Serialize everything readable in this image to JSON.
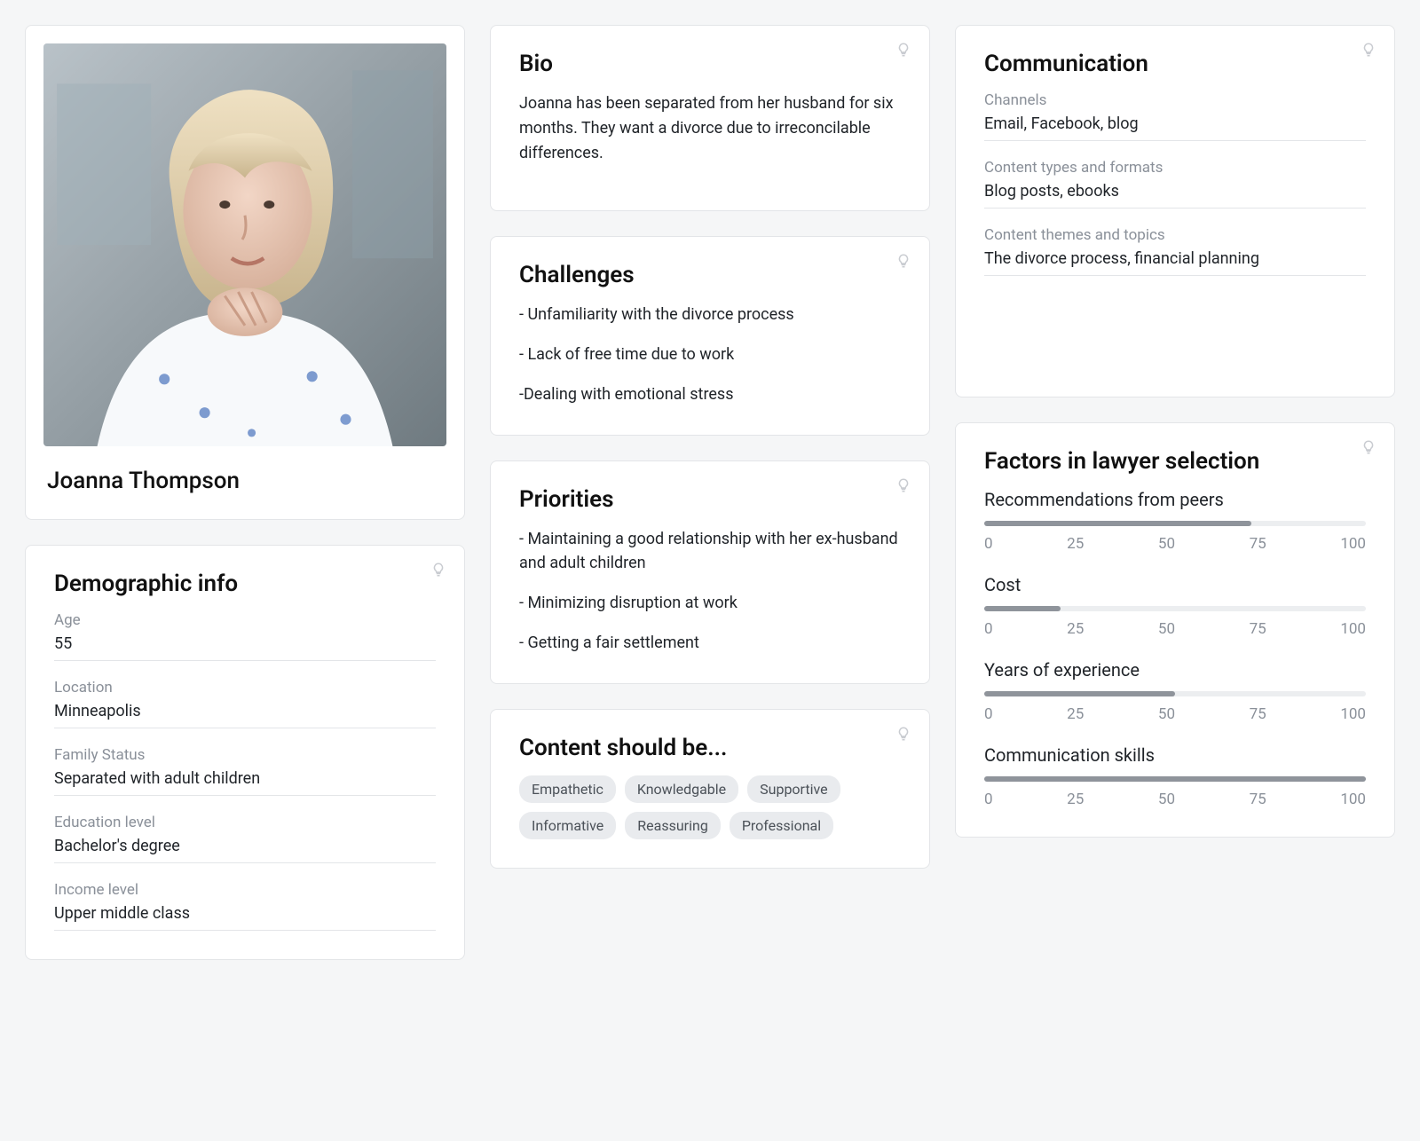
{
  "persona": {
    "name": "Joanna Thompson"
  },
  "bio": {
    "title": "Bio",
    "text": "Joanna has been separated from her husband for six months. They want a divorce due to irreconcilable differences."
  },
  "challenges": {
    "title": "Challenges",
    "items": [
      "- Unfamiliarity with the divorce process",
      "- Lack of free time due to work",
      "-Dealing with emotional stress"
    ]
  },
  "demographic": {
    "title": "Demographic info",
    "fields": [
      {
        "label": "Age",
        "value": "55"
      },
      {
        "label": "Location",
        "value": "Minneapolis"
      },
      {
        "label": "Family Status",
        "value": "Separated with adult children"
      },
      {
        "label": "Education level",
        "value": "Bachelor's degree"
      },
      {
        "label": "Income level",
        "value": "Upper middle class"
      }
    ]
  },
  "priorities": {
    "title": "Priorities",
    "items": [
      "- Maintaining a good relationship with her ex-husband and adult children",
      "- Minimizing disruption at work",
      "- Getting a fair settlement"
    ]
  },
  "content_should_be": {
    "title": "Content should be...",
    "tags": [
      "Empathetic",
      "Knowledgable",
      "Supportive",
      "Informative",
      "Reassuring",
      "Professional"
    ]
  },
  "communication": {
    "title": "Communication",
    "fields": [
      {
        "label": "Channels",
        "value": "Email, Facebook, blog"
      },
      {
        "label": "Content types and formats",
        "value": "Blog posts, ebooks"
      },
      {
        "label": "Content themes and topics",
        "value": "The divorce process, financial planning"
      }
    ]
  },
  "factors": {
    "title": "Factors in lawyer selection",
    "scale": {
      "min": 0,
      "max": 100,
      "ticks": [
        "0",
        "25",
        "50",
        "75",
        "100"
      ]
    },
    "items": [
      {
        "label": "Recommendations from peers",
        "value": 70
      },
      {
        "label": "Cost",
        "value": 20
      },
      {
        "label": "Years of experience",
        "value": 50
      },
      {
        "label": "Communication skills",
        "value": 100
      }
    ]
  }
}
